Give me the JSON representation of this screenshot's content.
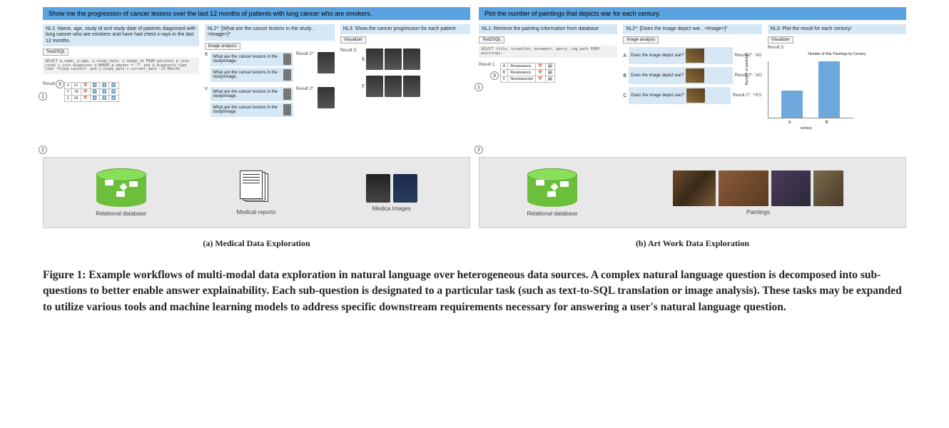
{
  "panelA": {
    "header": "Show me the progression of cancer lesions over the last 12 months of patients with lung cancer who are smokers.",
    "nl1": "NL1: Name, age, study Id and study date of patients diagnosed with lung cancer who are smokers and have had chest x-rays in the last 12 months.",
    "tag1": "Text2SQL",
    "sql": "SELECT p.name, p.age, s.study_date, s.image_id FROM patients p join study s  join diagnoses d WHERE  p.smoker = 'T' and d.diagnosis_type like '%lung cancer%' and s.study_date > current_date -12 Months",
    "result1_label": "Result 1:",
    "table_rows": [
      [
        "X",
        "57"
      ],
      [
        "Y",
        "78"
      ],
      [
        "Z",
        "59"
      ]
    ],
    "nl2": "NL2*: [What are the cancer lesions in the study , <Image>]*",
    "tag2": "Image analysis",
    "img_analysis_q": "What are the cancer lesions in the study/image.",
    "result2_label": "Result 2*:",
    "nl3": "NL3: Show the cancer progression for each patient",
    "tag3": "Visualizer",
    "result3_label": "Result 3:",
    "patients": [
      "X",
      "Y"
    ],
    "src_db": "Relational database",
    "src_docs": "Medical reports",
    "src_imgs": "Medica Images",
    "subcaption": "(a) Medical Data Exploration",
    "steps": [
      "1",
      "2",
      "3"
    ]
  },
  "panelB": {
    "header": "Plot the number of paintings that depicts war for each century.",
    "nl1": "NL1: Retrieve the painting information from database",
    "tag1": "Text2SQL",
    "sql": "SELECT title, inception, movement, genre, img_path FROM paintings;",
    "result1_label": "Result 1:",
    "table_rows": [
      [
        "A",
        "Renaissance"
      ],
      [
        "B",
        "Renaissance"
      ],
      [
        "C",
        "Neoclassicism"
      ]
    ],
    "nl2": "NL2*: [Does the image depict war , <Image>]*",
    "tag2": "Image analysis",
    "img_analysis_q": "Does the image depict war?",
    "items": [
      "A",
      "B",
      "C"
    ],
    "answers": [
      "NO",
      "NO",
      "YES"
    ],
    "result2_label": "Result 2*:",
    "nl3": "NL3: Plot the result for each century!",
    "tag3": "Visualizer",
    "result3_label": "Result 3:",
    "chart_title": "Number of War Paintings by Century",
    "src_db": "Relational database",
    "src_paintings": "Paintings",
    "subcaption": "(b) Art Work Data Exploration",
    "steps": [
      "1",
      "2",
      "3"
    ]
  },
  "chart_data": {
    "type": "bar",
    "categories": [
      "A",
      "B"
    ],
    "values": [
      120,
      200
    ],
    "title": "Number of War Paintings by Century",
    "xlabel": "century",
    "ylabel": "Number of paintings",
    "ylim": [
      0,
      200
    ]
  },
  "caption": "Figure 1: Example workflows of multi-modal data exploration in natural language over heterogeneous data sources. A complex natural language question is decomposed into sub-questions to better enable answer explainability. Each sub-question is designated to a particular task (such as text-to-SQL translation or image analysis). These tasks may be expanded to utilize various tools and machine learning models to address specific downstream requirements necessary for answering a user's natural language question."
}
